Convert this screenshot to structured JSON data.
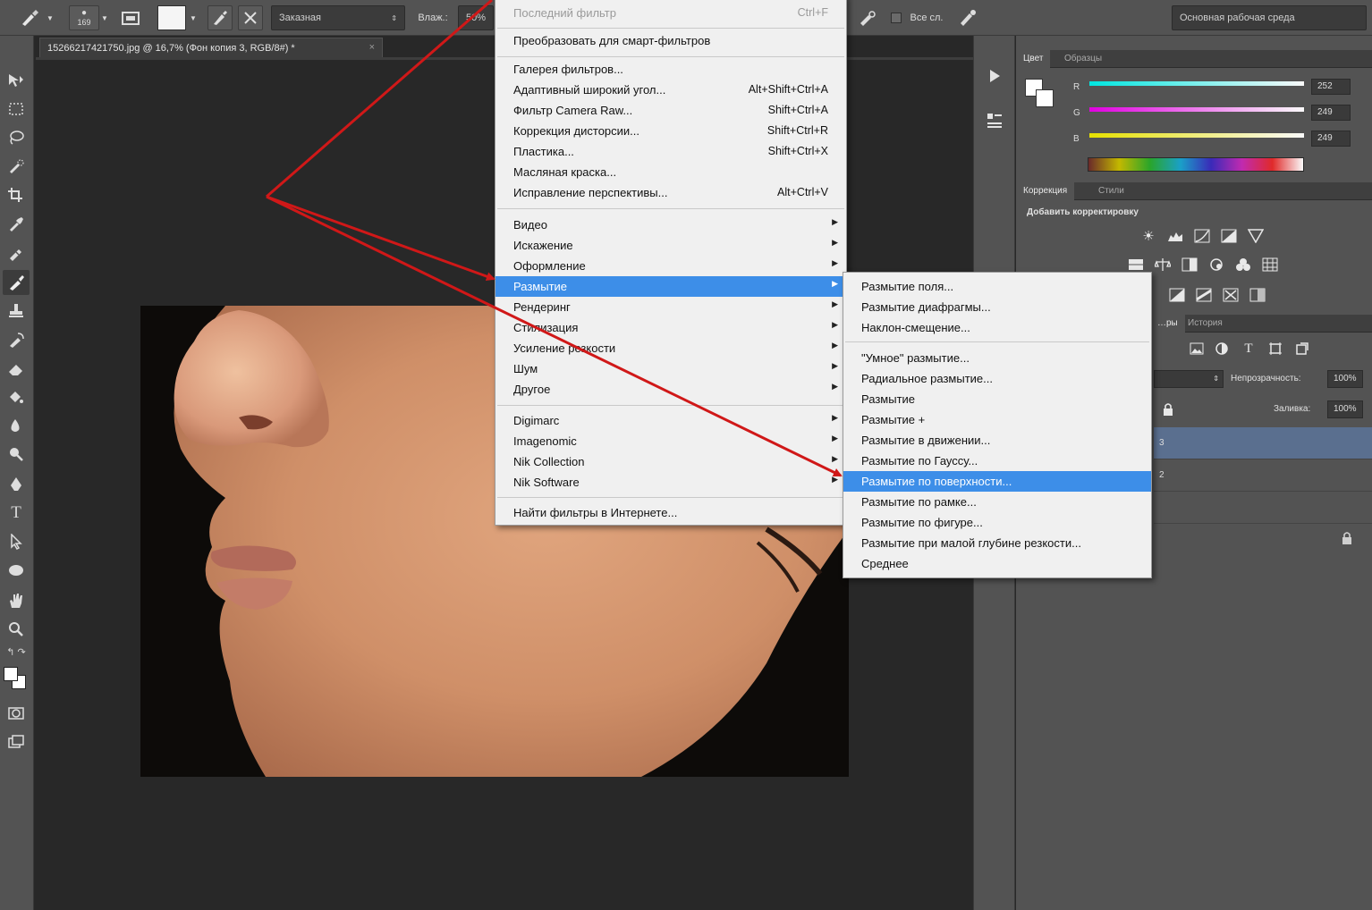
{
  "options_bar": {
    "brush_size": "169",
    "mode_value": "Заказная",
    "flow_label": "Влаж.:",
    "flow_value": "50%",
    "all_layers_label": "Все сл.",
    "workspace": "Основная рабочая среда"
  },
  "document_tab": {
    "title": "15266217421750.jpg @ 16,7% (Фон копия 3, RGB/8#) *",
    "close": "×"
  },
  "filter_menu": {
    "items": [
      {
        "label": "Последний фильтр",
        "shortcut": "Ctrl+F"
      },
      {
        "label": "Преобразовать для смарт-фильтров",
        "shortcut": ""
      },
      {
        "label": "Галерея фильтров...",
        "shortcut": ""
      },
      {
        "label": "Адаптивный широкий угол...",
        "shortcut": "Alt+Shift+Ctrl+A"
      },
      {
        "label": "Фильтр Camera Raw...",
        "shortcut": "Shift+Ctrl+A"
      },
      {
        "label": "Коррекция дисторсии...",
        "shortcut": "Shift+Ctrl+R"
      },
      {
        "label": "Пластика...",
        "shortcut": "Shift+Ctrl+X"
      },
      {
        "label": "Масляная краска...",
        "shortcut": ""
      },
      {
        "label": "Исправление перспективы...",
        "shortcut": "Alt+Ctrl+V"
      },
      {
        "label": "Видео",
        "shortcut": ""
      },
      {
        "label": "Искажение",
        "shortcut": ""
      },
      {
        "label": "Оформление",
        "shortcut": ""
      },
      {
        "label": "Размытие",
        "shortcut": ""
      },
      {
        "label": "Рендеринг",
        "shortcut": ""
      },
      {
        "label": "Стилизация",
        "shortcut": ""
      },
      {
        "label": "Усиление резкости",
        "shortcut": ""
      },
      {
        "label": "Шум",
        "shortcut": ""
      },
      {
        "label": "Другое",
        "shortcut": ""
      },
      {
        "label": "Digimarc",
        "shortcut": ""
      },
      {
        "label": "Imagenomic",
        "shortcut": ""
      },
      {
        "label": "Nik Collection",
        "shortcut": ""
      },
      {
        "label": "Nik Software",
        "shortcut": ""
      },
      {
        "label": "Найти фильтры в Интернете...",
        "shortcut": ""
      }
    ]
  },
  "blur_submenu": {
    "items": [
      {
        "label": "Размытие поля..."
      },
      {
        "label": "Размытие диафрагмы..."
      },
      {
        "label": "Наклон-смещение..."
      },
      {
        "label": "\"Умное\" размытие..."
      },
      {
        "label": "Радиальное размытие..."
      },
      {
        "label": "Размытие"
      },
      {
        "label": "Размытие +"
      },
      {
        "label": "Размытие в движении..."
      },
      {
        "label": "Размытие по Гауссу..."
      },
      {
        "label": "Размытие по поверхности..."
      },
      {
        "label": "Размытие по рамке..."
      },
      {
        "label": "Размытие по фигуре..."
      },
      {
        "label": "Размытие при малой глубине резкости..."
      },
      {
        "label": "Среднее"
      }
    ]
  },
  "color_panel": {
    "tabs": [
      "Цвет",
      "Образцы"
    ],
    "channels": [
      {
        "label": "R",
        "value": "252"
      },
      {
        "label": "G",
        "value": "249"
      },
      {
        "label": "B",
        "value": "249"
      }
    ]
  },
  "adjustments_panel": {
    "tabs": [
      "Коррекция",
      "Стили"
    ],
    "heading": "Добавить корректировку"
  },
  "layers_panel": {
    "tabs": [
      "…ры",
      "История"
    ],
    "opacity_label": "Непрозрачность:",
    "opacity_value": "100%",
    "fill_label": "Заливка:",
    "fill_value": "100%",
    "rows": [
      "3",
      "2"
    ]
  },
  "colors": {
    "menu_highlight": "#3d8ee8",
    "annotation_arrow": "#d01818"
  }
}
